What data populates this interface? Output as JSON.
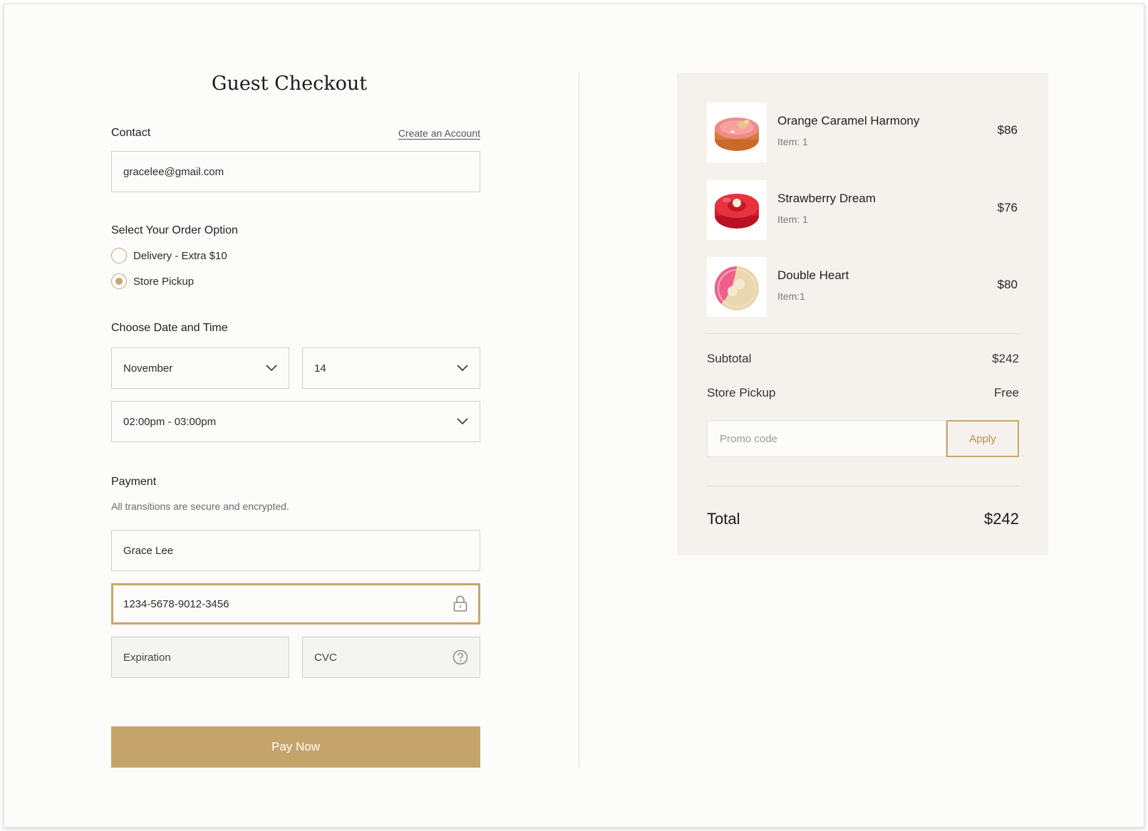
{
  "title": "Guest Checkout",
  "contact": {
    "label": "Contact",
    "create_account": "Create an Account",
    "email": "gracelee@gmail.com"
  },
  "order_option": {
    "label": "Select Your Order Option",
    "options": [
      {
        "label": "Delivery - Extra $10",
        "selected": false
      },
      {
        "label": "Store Pickup",
        "selected": true
      }
    ]
  },
  "date_time": {
    "label": "Choose Date and Time",
    "month": "November",
    "day": "14",
    "time": "02:00pm - 03:00pm"
  },
  "payment": {
    "label": "Payment",
    "note": "All transitions are secure and encrypted.",
    "name": "Grace Lee",
    "card_number": "1234-5678-9012-3456",
    "expiration_placeholder": "Expiration",
    "cvc_placeholder": "CVC",
    "pay_button": "Pay Now"
  },
  "summary": {
    "items": [
      {
        "name": "Orange Caramel Harmony",
        "qty": "Item: 1",
        "price": "$86"
      },
      {
        "name": "Strawberry Dream",
        "qty": "Item: 1",
        "price": "$76"
      },
      {
        "name": "Double Heart",
        "qty": "Item:1",
        "price": "$80"
      }
    ],
    "subtotal_label": "Subtotal",
    "subtotal_value": "$242",
    "pickup_label": "Store Pickup",
    "pickup_value": "Free",
    "promo_placeholder": "Promo code",
    "apply_label": "Apply",
    "total_label": "Total",
    "total_value": "$242"
  },
  "colors": {
    "accent": "#c5a46b",
    "panel_bg": "#f5f2ee",
    "page_bg": "#fcfcfb"
  }
}
